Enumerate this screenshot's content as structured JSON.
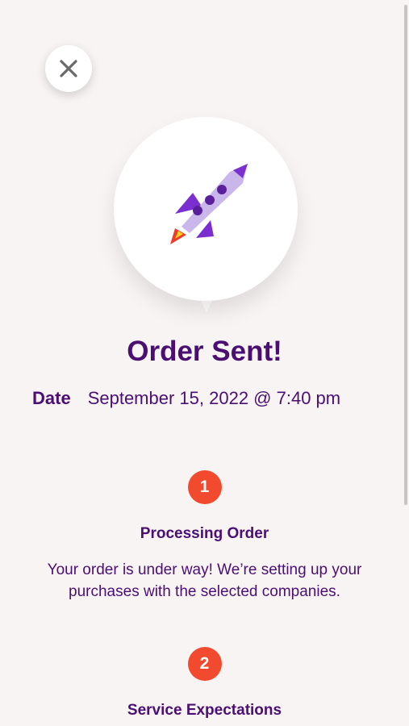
{
  "title": "Order Sent!",
  "date": {
    "label": "Date",
    "value": "September 15, 2022 @ 7:40 pm"
  },
  "steps": [
    {
      "number": "1",
      "title": "Processing Order",
      "text": "Your order is under way! We’re setting up your purchases with the selected companies."
    },
    {
      "number": "2",
      "title": "Service Expectations",
      "text": ""
    }
  ],
  "icons": {
    "close": "close-icon",
    "hero": "rocket-icon"
  },
  "colors": {
    "background": "#f8f4f4",
    "brand_purple": "#4b0f73",
    "accent_orange": "#f24a2e",
    "rocket_light": "#c9b6ea",
    "rocket_dark": "#7b2fd0",
    "flame_red": "#ee3b2e",
    "flame_yellow": "#ffd21a"
  }
}
